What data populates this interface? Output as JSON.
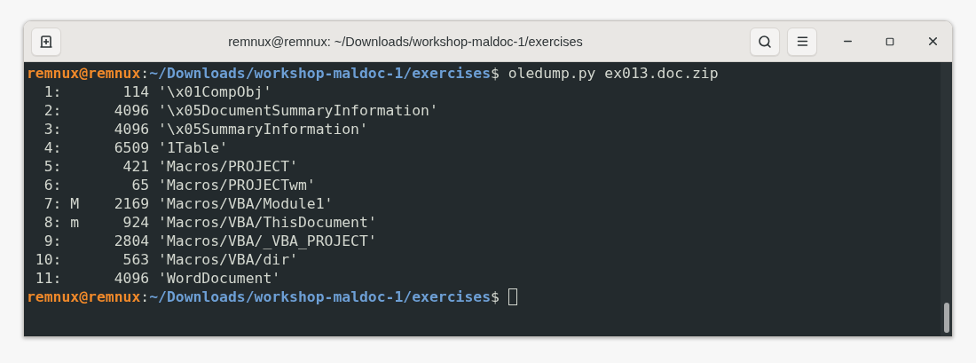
{
  "window": {
    "title": "remnux@remnux: ~/Downloads/workshop-maldoc-1/exercises"
  },
  "terminal": {
    "lines": [
      {
        "kind": "prompt",
        "user": "remnux@remnux",
        "sep": ":",
        "path": "~/Downloads/workshop-maldoc-1/exercises",
        "symbol": "$",
        "command": "oledump.py ex013.doc.zip"
      },
      {
        "kind": "output",
        "text": "  1:       114 '\\x01CompObj'"
      },
      {
        "kind": "output",
        "text": "  2:      4096 '\\x05DocumentSummaryInformation'"
      },
      {
        "kind": "output",
        "text": "  3:      4096 '\\x05SummaryInformation'"
      },
      {
        "kind": "output",
        "text": "  4:      6509 '1Table'"
      },
      {
        "kind": "output",
        "text": "  5:       421 'Macros/PROJECT'"
      },
      {
        "kind": "output",
        "text": "  6:        65 'Macros/PROJECTwm'"
      },
      {
        "kind": "output",
        "text": "  7: M    2169 'Macros/VBA/Module1'"
      },
      {
        "kind": "output",
        "text": "  8: m     924 'Macros/VBA/ThisDocument'"
      },
      {
        "kind": "output",
        "text": "  9:      2804 'Macros/VBA/_VBA_PROJECT'"
      },
      {
        "kind": "output",
        "text": " 10:       563 'Macros/VBA/dir'"
      },
      {
        "kind": "output",
        "text": " 11:      4096 'WordDocument'"
      },
      {
        "kind": "prompt",
        "user": "remnux@remnux",
        "sep": ":",
        "path": "~/Downloads/workshop-maldoc-1/exercises",
        "symbol": "$",
        "cursor": true
      }
    ]
  }
}
